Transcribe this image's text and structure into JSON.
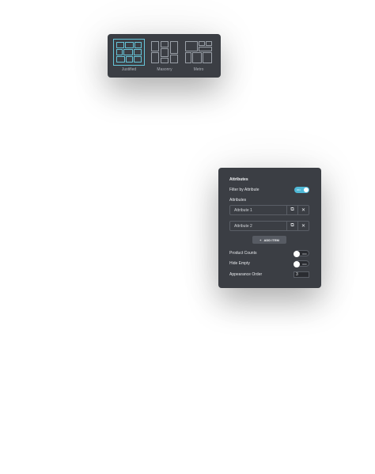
{
  "layout_picker": {
    "options": [
      {
        "label": "Justified",
        "active": true
      },
      {
        "label": "Masonry",
        "active": false
      },
      {
        "label": "Metro",
        "active": false
      }
    ],
    "accent_color": "#66c6da"
  },
  "attributes_panel": {
    "title": "Attributes",
    "filter_by_attribute": {
      "label": "Filter by Attribute",
      "state_text": "ON",
      "on": true
    },
    "attributes_label": "Attributes",
    "items": [
      {
        "label": "Attribute 1",
        "copy_icon": "copy-icon",
        "remove_icon": "close-icon"
      },
      {
        "label": "Attribute 2",
        "copy_icon": "copy-icon",
        "remove_icon": "close-icon"
      }
    ],
    "add_button": {
      "label": "ADD ITEM",
      "icon": "plus-icon"
    },
    "product_counts": {
      "label": "Product Counts",
      "state_text": "OFF",
      "on": false
    },
    "hide_empty": {
      "label": "Hide Empty",
      "state_text": "OFF",
      "on": false
    },
    "appearance_order": {
      "label": "Appearance Order",
      "value": "3"
    },
    "toggle_on_color": "#4fb8d6"
  }
}
